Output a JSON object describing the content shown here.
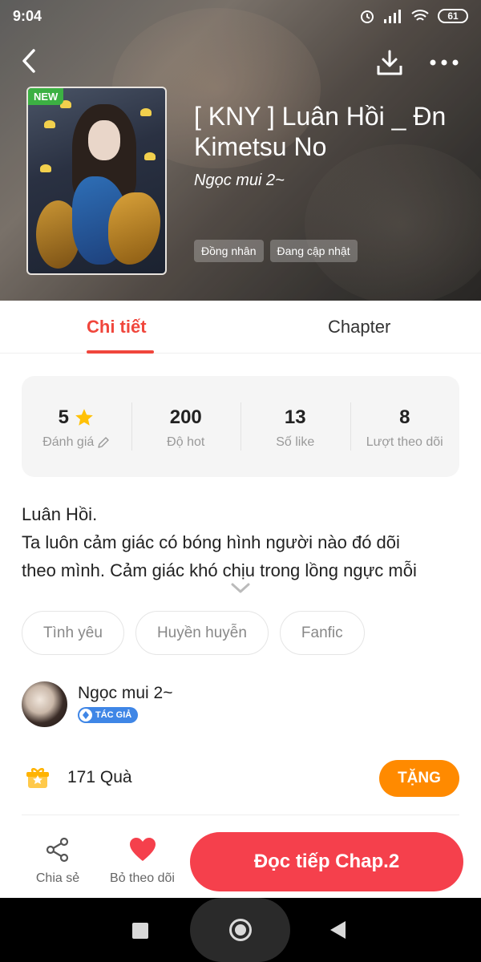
{
  "status_bar": {
    "time": "9:04",
    "battery": "61"
  },
  "book": {
    "badge": "NEW",
    "title": "[ KNY ] Luân Hồi _ Đn Kimetsu No",
    "author": "Ngọc mui 2~",
    "header_tags": [
      "Đồng nhân",
      "Đang cập nhật"
    ]
  },
  "tabs": {
    "detail": "Chi tiết",
    "chapter": "Chapter"
  },
  "stats": [
    {
      "value": "5",
      "label": "Đánh giá"
    },
    {
      "value": "200",
      "label": "Độ hot"
    },
    {
      "value": "13",
      "label": "Số like"
    },
    {
      "value": "8",
      "label": "Lượt theo dõi"
    }
  ],
  "description": {
    "line1": "Luân Hồi.",
    "line2": "Ta luôn cảm giác có bóng hình người nào đó dõi",
    "line3": "theo mình. Cảm giác khó chịu trong lồng ngực mỗi"
  },
  "genres": [
    "Tình yêu",
    "Huyền huyễn",
    "Fanfic"
  ],
  "author_section": {
    "name": "Ngọc mui 2~",
    "badge": "TÁC GIẢ"
  },
  "gifts": {
    "count_text": "171 Quà",
    "button": "TẶNG"
  },
  "bottom_bar": {
    "share": "Chia sẻ",
    "follow": "Bỏ theo dõi",
    "read": "Đọc tiếp Chap.2"
  },
  "colors": {
    "accent": "#f0463c",
    "read_button": "#f5404c",
    "gift_button": "#ff8a00",
    "star": "#ffc107"
  }
}
